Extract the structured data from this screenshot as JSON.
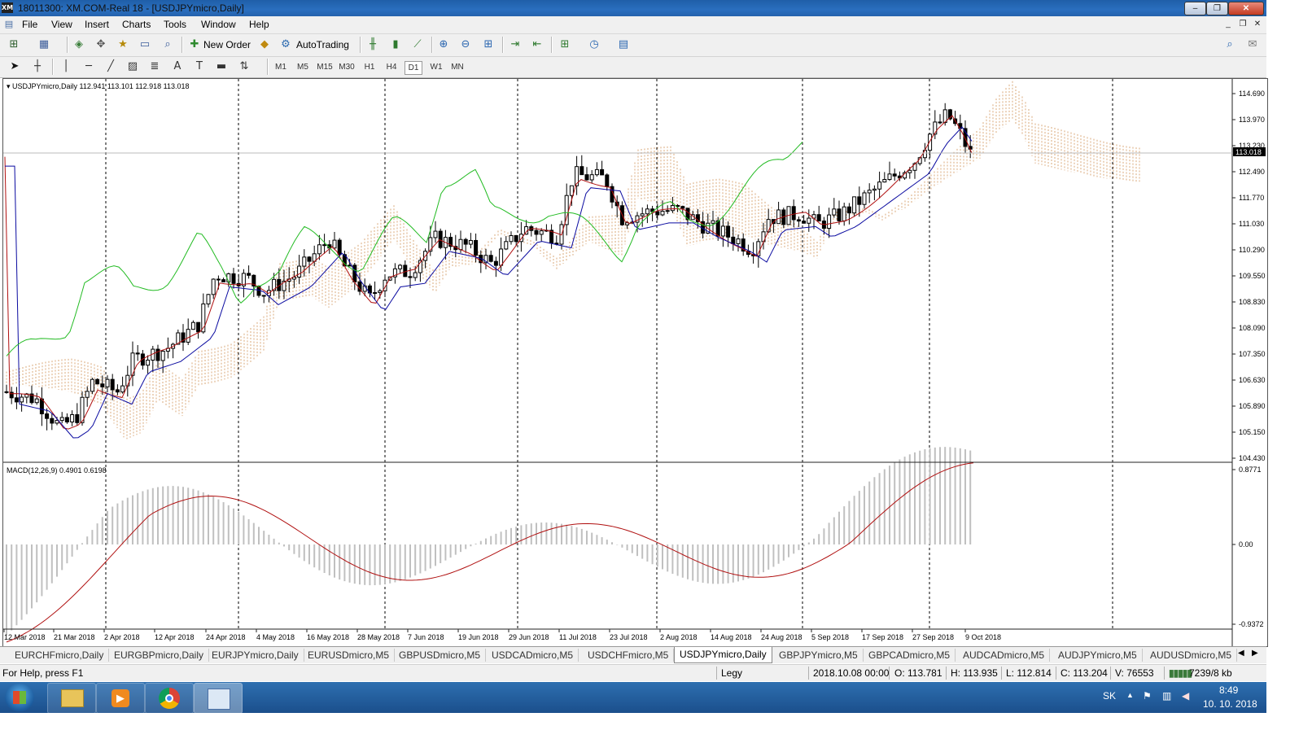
{
  "window": {
    "title": "18011300: XM.COM-Real 18 - [USDJPYmicro,Daily]",
    "logo": "XM",
    "min": "–",
    "max": "❐",
    "close": "✕"
  },
  "menu": [
    "File",
    "View",
    "Insert",
    "Charts",
    "Tools",
    "Window",
    "Help"
  ],
  "toolbar": {
    "new_order": "New Order",
    "auto_trading": "AutoTrading"
  },
  "timeframes": [
    "M1",
    "M5",
    "M15",
    "M30",
    "H1",
    "H4",
    "D1",
    "W1",
    "MN"
  ],
  "active_timeframe": "D1",
  "chart": {
    "header": "USDJPYmicro,Daily  112.941 113.101 112.918 113.018",
    "current_price": "113.018",
    "price_axis": [
      "114.690",
      "113.970",
      "113.230",
      "112.490",
      "111.770",
      "111.030",
      "110.290",
      "109.550",
      "108.830",
      "108.090",
      "107.350",
      "106.630",
      "105.890",
      "105.150",
      "104.430"
    ],
    "time_axis": [
      "12 Mar 2018",
      "21 Mar 2018",
      "2 Apr 2018",
      "12 Apr 2018",
      "24 Apr 2018",
      "4 May 2018",
      "16 May 2018",
      "28 May 2018",
      "7 Jun 2018",
      "19 Jun 2018",
      "29 Jun 2018",
      "11 Jul 2018",
      "23 Jul 2018",
      "2 Aug 2018",
      "14 Aug 2018",
      "24 Aug 2018",
      "5 Sep 2018",
      "17 Sep 2018",
      "27 Sep 2018",
      "9 Oct 2018"
    ],
    "macd_header": "MACD(12,26,9) 0.4901 0.6198",
    "macd_axis": [
      "0.8771",
      "0.00",
      "-0.9372"
    ],
    "colors": {
      "tenkan": "#b01010",
      "kijun": "#0a0aa0",
      "chikou": "#22bb22",
      "cloud_up": "#d2935a",
      "cloud_down": "#a8a8a8",
      "macd_hist": "#c0c0c0",
      "macd_signal": "#b01010"
    }
  },
  "tabs": [
    "EURCHFmicro,Daily",
    "EURGBPmicro,Daily",
    "EURJPYmicro,Daily",
    "EURUSDmicro,M5",
    "GBPUSDmicro,M5",
    "USDCADmicro,M5",
    "USDCHFmicro,M5",
    "USDJPYmicro,Daily",
    "GBPJPYmicro,M5",
    "GBPCADmicro,M5",
    "AUDCADmicro,M5",
    "AUDJPYmicro,M5",
    "AUDUSDmicro,M5"
  ],
  "active_tab": "USDJPYmicro,Daily",
  "status": {
    "help": "For Help, press F1",
    "profile": "Legy",
    "datetime": "2018.10.08 00:00",
    "open": "O: 113.781",
    "high": "H: 113.935",
    "low": "L: 112.814",
    "close": "C: 113.204",
    "volume": "V: 76553",
    "traffic": "7239/8 kb"
  },
  "taskbar": {
    "lang": "SK",
    "time": "8:49",
    "date": "10. 10. 2018"
  }
}
